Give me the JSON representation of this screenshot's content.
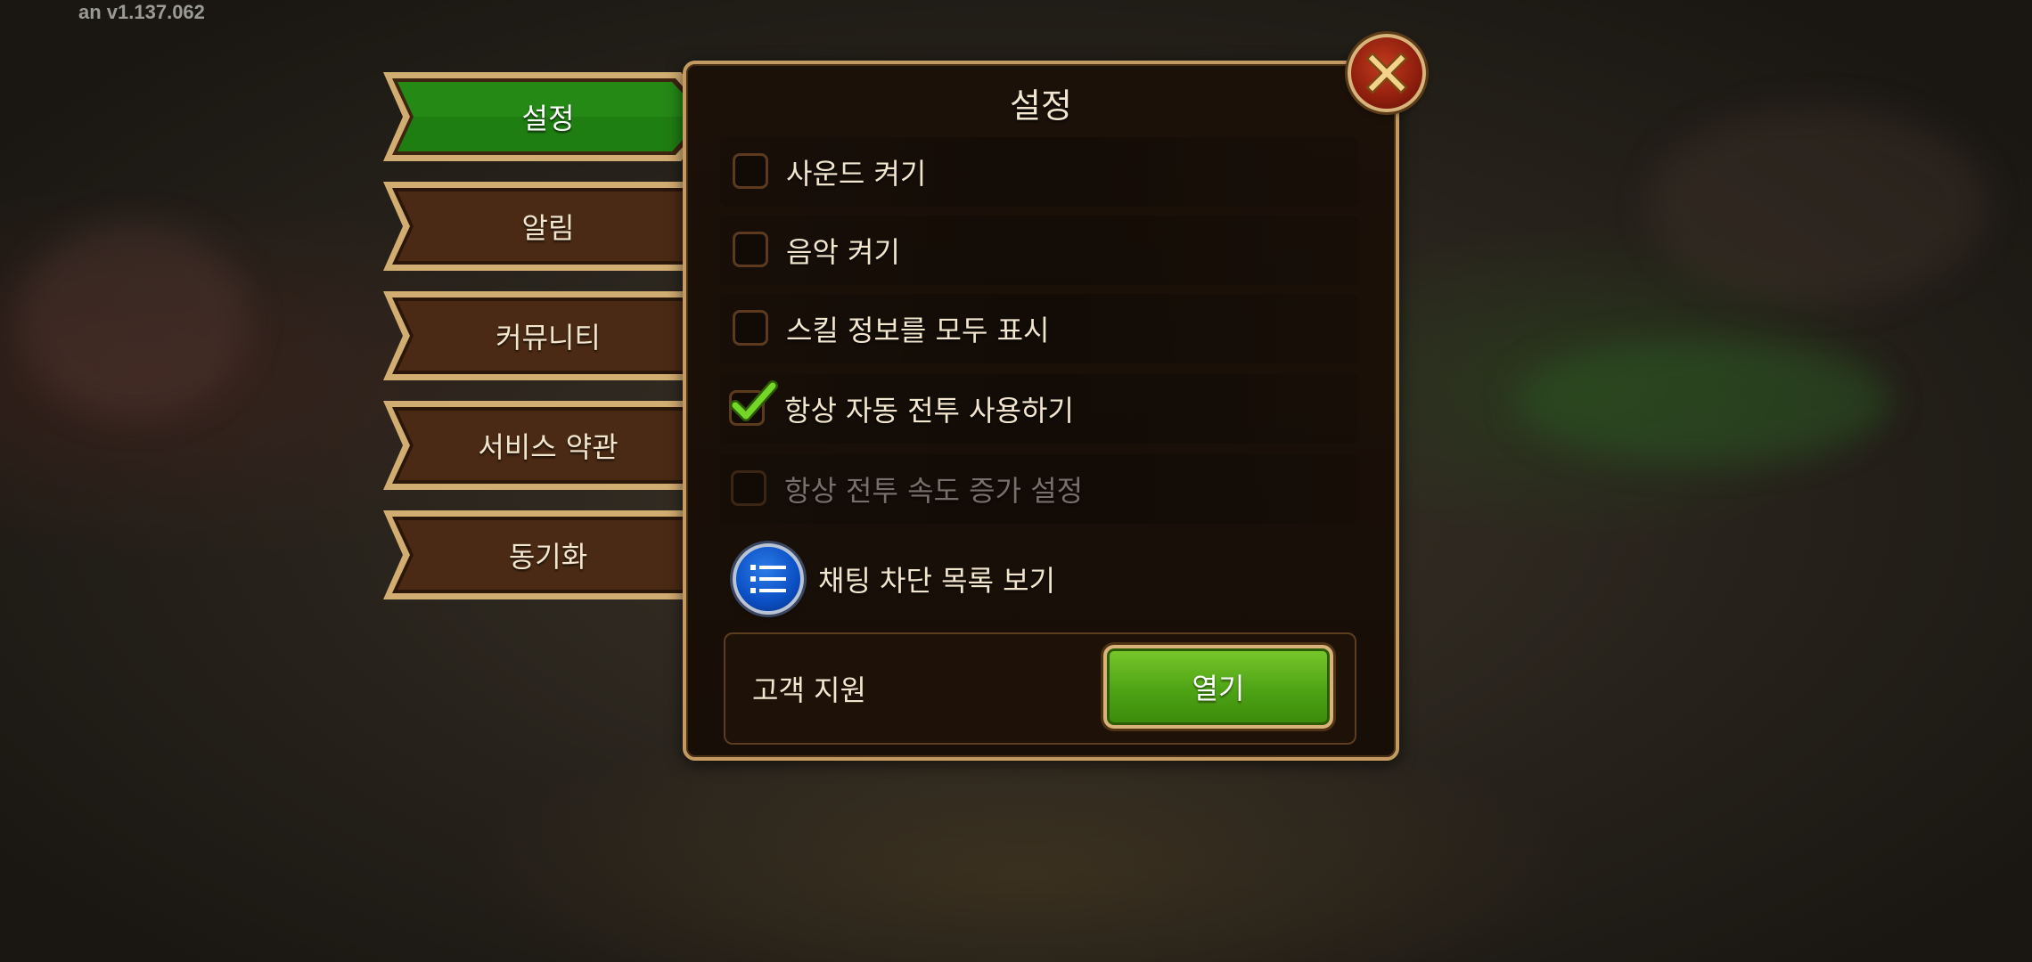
{
  "version_text": "an v1.137.062",
  "tabs": [
    {
      "label": "설정",
      "active": true
    },
    {
      "label": "알림",
      "active": false
    },
    {
      "label": "커뮤니티",
      "active": false
    },
    {
      "label": "서비스 약관",
      "active": false
    },
    {
      "label": "동기화",
      "active": false
    }
  ],
  "panel": {
    "title": "설정",
    "options": [
      {
        "label": "사운드 켜기",
        "checked": false,
        "disabled": false
      },
      {
        "label": "음악 켜기",
        "checked": false,
        "disabled": false
      },
      {
        "label": "스킬 정보를 모두 표시",
        "checked": false,
        "disabled": false
      },
      {
        "label": "항상 자동 전투 사용하기",
        "checked": true,
        "disabled": false
      },
      {
        "label": "항상 전투 속도 증가 설정",
        "checked": false,
        "disabled": true
      }
    ],
    "block_list_label": "채팅 차단 목록 보기",
    "support": {
      "label": "고객 지원",
      "button_label": "열기"
    }
  },
  "icons": {
    "close": "close-icon",
    "list": "list-icon",
    "check": "checkmark-icon"
  },
  "colors": {
    "active_tab": "#1e7a12",
    "inactive_tab": "#4a2a14",
    "frame_gold": "#c39a62",
    "open_button": "#4ea315",
    "close_button": "#a8260f",
    "list_button": "#0b4fc4",
    "check_green": "#6fd321"
  }
}
